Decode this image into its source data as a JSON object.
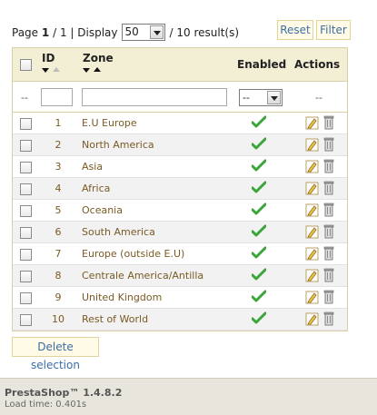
{
  "pagination": {
    "page_label": "Page",
    "current_page": "1",
    "separator": "/",
    "total_pages": "1",
    "display_label": "| Display",
    "per_page_value": "50",
    "results_text": "/ 10 result(s)"
  },
  "buttons": {
    "reset": "Reset",
    "filter": "Filter",
    "delete_selection": "Delete selection"
  },
  "table": {
    "headers": {
      "id": "ID",
      "zone": "Zone",
      "enabled": "Enabled",
      "actions": "Actions"
    },
    "filter": {
      "blank_left": "--",
      "enabled_value": "--",
      "blank_right": "--"
    },
    "rows": [
      {
        "id": "1",
        "zone": "E.U Europe",
        "enabled": true
      },
      {
        "id": "2",
        "zone": "North America",
        "enabled": true
      },
      {
        "id": "3",
        "zone": "Asia",
        "enabled": true
      },
      {
        "id": "4",
        "zone": "Africa",
        "enabled": true
      },
      {
        "id": "5",
        "zone": "Oceania",
        "enabled": true
      },
      {
        "id": "6",
        "zone": "South America",
        "enabled": true
      },
      {
        "id": "7",
        "zone": "Europe (outside E.U)",
        "enabled": true
      },
      {
        "id": "8",
        "zone": "Centrale America/Antilla",
        "enabled": true
      },
      {
        "id": "9",
        "zone": "United Kingdom",
        "enabled": true
      },
      {
        "id": "10",
        "zone": "Rest of World",
        "enabled": true
      }
    ]
  },
  "footer": {
    "version": "PrestaShop™ 1.4.8.2",
    "load_time": "Load time: 0.401s"
  },
  "colors": {
    "header_bg": "#f3efd4",
    "link": "#3b6ea5",
    "row_text": "#7a5a24",
    "check_green": "#3aa63a"
  },
  "icons": {
    "enabled": "check-icon",
    "edit": "pencil-icon",
    "delete": "trash-icon"
  }
}
